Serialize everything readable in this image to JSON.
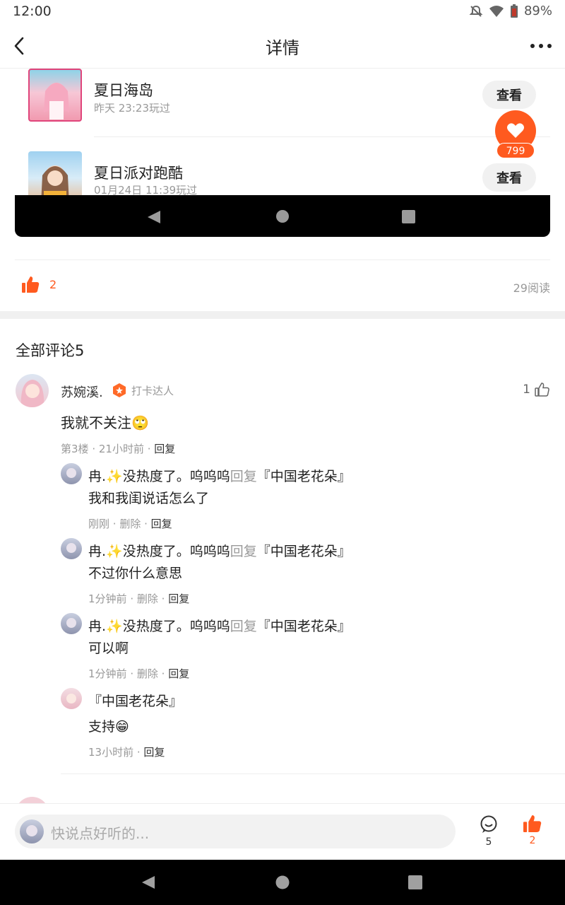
{
  "status_bar": {
    "time": "12:00",
    "battery": "89%"
  },
  "header": {
    "title": "详情"
  },
  "games": [
    {
      "name": "夏日海岛",
      "time": "昨天 23:23玩过",
      "button": "查看"
    },
    {
      "name": "夏日派对跑酷",
      "time": "01月24日 11:39玩过",
      "button": "查看"
    }
  ],
  "floating_like": {
    "count": "799"
  },
  "post_stats": {
    "likes": "2",
    "reads": "29阅读"
  },
  "comments_section": {
    "title": "全部评论5"
  },
  "comment": {
    "user": "苏婉溪.",
    "badge": "打卡达人",
    "like_count": "1",
    "text": "我就不关注🙄",
    "floor": "第3楼",
    "time": "21小时前",
    "reply": "回复",
    "replies": [
      {
        "user": "冉.✨没热度了。呜呜呜",
        "reply_word": "回复",
        "target": "『中国老花朵』",
        "text": "我和我闺说话怎么了",
        "time": "刚刚",
        "delete": "删除",
        "reply": "回复"
      },
      {
        "user": "冉.✨没热度了。呜呜呜",
        "reply_word": "回复",
        "target": "『中国老花朵』",
        "text": "不过你什么意思",
        "time": "1分钟前",
        "delete": "删除",
        "reply": "回复"
      },
      {
        "user": "冉.✨没热度了。呜呜呜",
        "reply_word": "回复",
        "target": "『中国老花朵』",
        "text": "可以啊",
        "time": "1分钟前",
        "delete": "删除",
        "reply": "回复"
      },
      {
        "user": "『中国老花朵』",
        "text": "支持😁",
        "time": "13小时前",
        "reply": "回复"
      }
    ]
  },
  "bottom_bar": {
    "placeholder": "快说点好听的...",
    "comment_count": "5",
    "like_count": "2"
  },
  "colors": {
    "accent": "#ff5a1f",
    "muted": "#999999"
  }
}
